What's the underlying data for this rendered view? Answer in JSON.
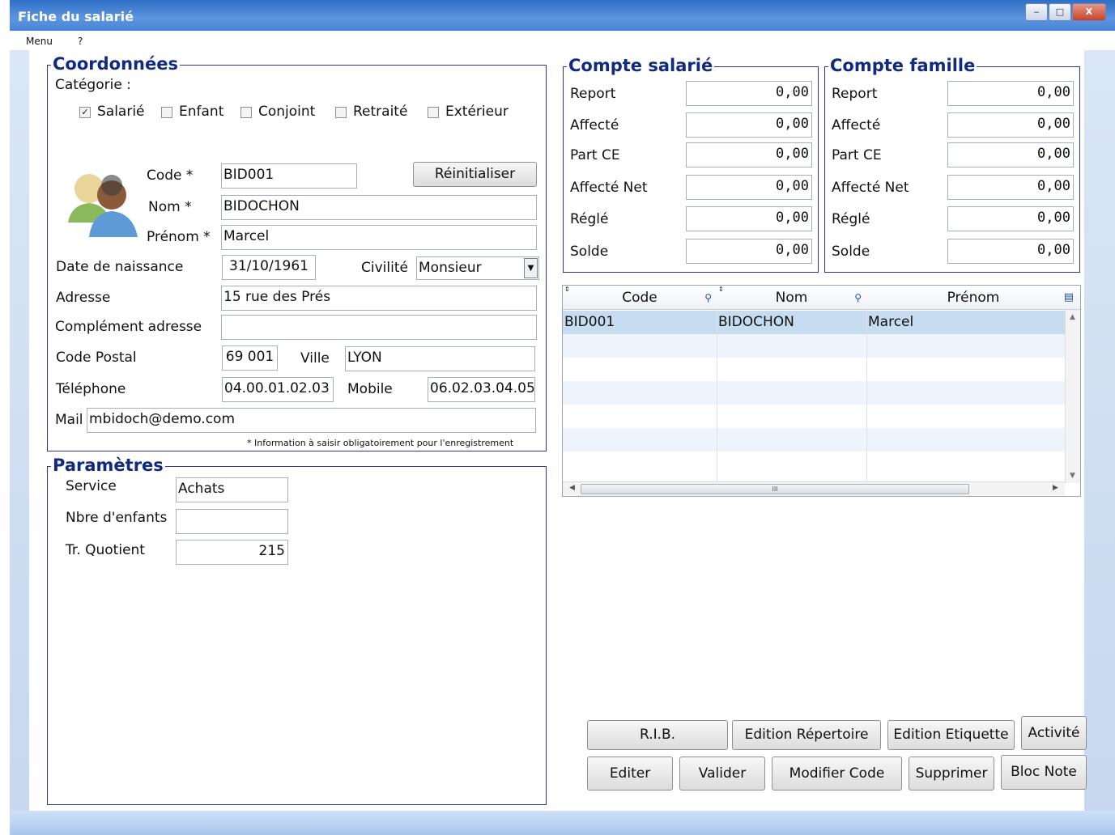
{
  "window": {
    "title": "Fiche du salarié",
    "min": "‒",
    "max": "□",
    "close": "X"
  },
  "menu": {
    "items": [
      "Menu",
      "?"
    ]
  },
  "coord": {
    "title": "Coordonnées",
    "cat_label": "Catégorie :",
    "categories": [
      {
        "label": "Salarié",
        "checked": true
      },
      {
        "label": "Enfant",
        "checked": false
      },
      {
        "label": "Conjoint",
        "checked": false
      },
      {
        "label": "Retraité",
        "checked": false
      },
      {
        "label": "Extérieur",
        "checked": false
      }
    ],
    "code_label": "Code *",
    "code": "BID001",
    "reset": "Réinitialiser",
    "nom_label": "Nom *",
    "nom": "BIDOCHON",
    "prenom_label": "Prénom *",
    "prenom": "Marcel",
    "dob_label": "Date de naissance",
    "dob": "31/10/1961",
    "civ_label": "Civilité",
    "civ": "Monsieur",
    "adr_label": "Adresse",
    "adr": "15 rue des Prés",
    "adr2_label": "Complément adresse",
    "adr2": "",
    "cp_label": "Code Postal",
    "cp": "69 001",
    "ville_label": "Ville",
    "ville": "LYON",
    "tel_label": "Téléphone",
    "tel": "04.00.01.02.03",
    "mob_label": "Mobile",
    "mob": "06.02.03.04.05",
    "mail_label": "Mail",
    "mail": "mbidoch@demo.com",
    "note": "* Information à saisir obligatoirement pour l'enregistrement"
  },
  "params": {
    "title": "Paramètres",
    "service_label": "Service",
    "service": "Achats",
    "enf_label": "Nbre d'enfants",
    "enf": "",
    "tr_label": "Tr. Quotient",
    "tr": "215"
  },
  "compte_sal": {
    "title": "Compte salarié",
    "rows": [
      {
        "label": "Report",
        "value": "0,00"
      },
      {
        "label": "Affecté",
        "value": "0,00"
      },
      {
        "label": "Part CE",
        "value": "0,00"
      },
      {
        "label": "Affecté Net",
        "value": "0,00"
      },
      {
        "label": "Réglé",
        "value": "0,00"
      },
      {
        "label": "Solde",
        "value": "0,00"
      }
    ]
  },
  "compte_fam": {
    "title": "Compte famille",
    "rows": [
      {
        "label": "Report",
        "value": "0,00"
      },
      {
        "label": "Affecté",
        "value": "0,00"
      },
      {
        "label": "Part CE",
        "value": "0,00"
      },
      {
        "label": "Affecté Net",
        "value": "0,00"
      },
      {
        "label": "Réglé",
        "value": "0,00"
      },
      {
        "label": "Solde",
        "value": "0,00"
      }
    ]
  },
  "table": {
    "headers": [
      "Code",
      "Nom",
      "Prénom"
    ],
    "rows": [
      [
        "BID001",
        "BIDOCHON",
        "Marcel"
      ]
    ],
    "hscroll_grip": "III"
  },
  "buttons": {
    "rib": "R.I.B.",
    "ed_rep": "Edition Répertoire",
    "ed_etq": "Edition Etiquette",
    "activite": "Activité",
    "editer": "Editer",
    "valider": "Valider",
    "modcode": "Modifier Code",
    "supprimer": "Supprimer",
    "blocnote": "Bloc Note"
  }
}
